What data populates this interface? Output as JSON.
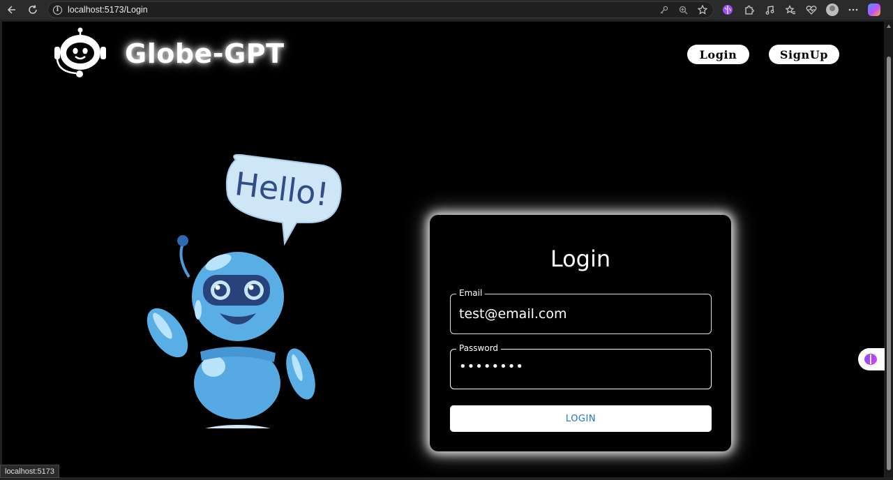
{
  "browser": {
    "url": "localhost:5173/Login",
    "status_url": "localhost:5173"
  },
  "header": {
    "brand": "Globe-GPT",
    "nav": {
      "login": "Login",
      "signup": "SignUp"
    }
  },
  "illustration": {
    "speech": "Hello!"
  },
  "login_form": {
    "title": "Login",
    "email_label": "Email",
    "email_value": "test@email.com",
    "password_label": "Password",
    "password_value": "••••••••",
    "submit_label": "LOGIN"
  },
  "colors": {
    "page_bg": "#000000",
    "robot_blue": "#5aaee6",
    "button_text": "#1976d2"
  },
  "icons": {
    "back": "arrow-left-icon",
    "reload": "reload-icon",
    "info": "info-icon",
    "key": "key-icon",
    "zoom": "zoom-icon",
    "favorite": "star-icon",
    "extension": "puzzle-icon",
    "profile": "avatar-icon",
    "copilot": "copilot-icon"
  }
}
